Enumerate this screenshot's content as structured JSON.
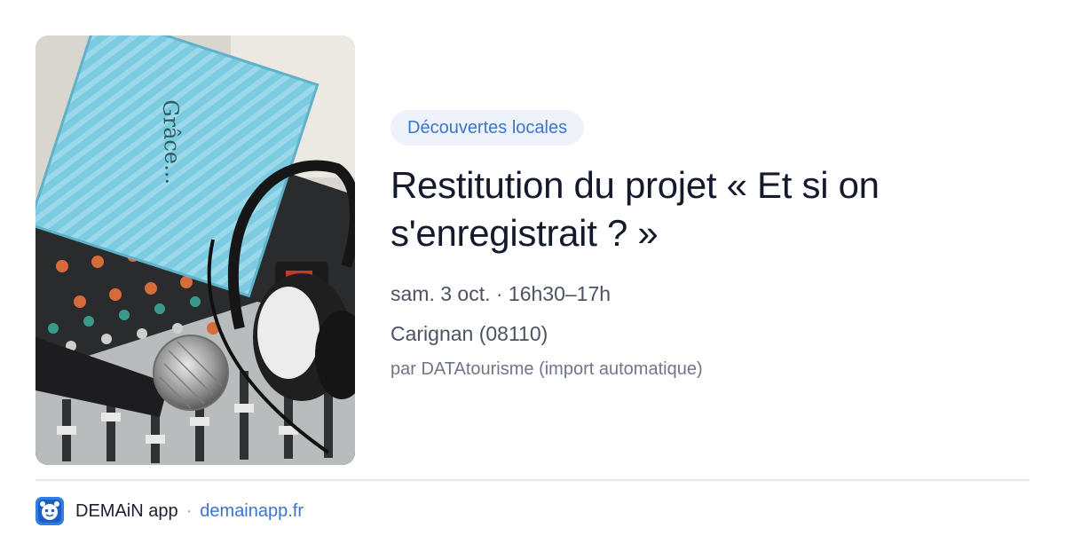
{
  "event": {
    "category": "Découvertes locales",
    "title": "Restitution du projet « Et si on s'enregistrait ? »",
    "datetime": "sam. 3 oct. · 16h30–17h",
    "location": "Carignan (08110)",
    "source": "par DATAtourisme (import automatique)",
    "image": {
      "book_cover_text": "Grâce...",
      "subject": "photo-book-headphones-microphone-mixer"
    }
  },
  "footer": {
    "app_name": "DEMAiN app",
    "separator": "·",
    "url": "demainapp.fr",
    "icon": "demain-app-icon"
  },
  "colors": {
    "accent": "#3a74cf",
    "badge_bg": "#eef2fa",
    "title": "#141a2c",
    "meta": "#4b5261",
    "muted": "#6f7686"
  }
}
